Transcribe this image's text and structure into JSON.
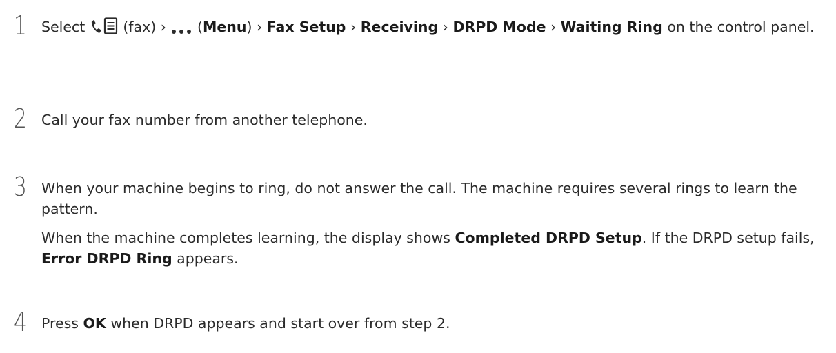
{
  "steps": [
    {
      "number": "1",
      "t_select": "Select",
      "t_fax": "(fax) ›",
      "t_menu_open": "(",
      "menu": "Menu",
      "t_menu_close": ") ›",
      "fax_setup": "Fax Setup",
      "sep1": "›",
      "receiving": "Receiving",
      "sep2": "›",
      "drpd_mode": "DRPD Mode",
      "sep3": "›",
      "waiting_ring": "Waiting Ring",
      "t_tail": "on the control panel."
    },
    {
      "number": "2",
      "text": "Call your fax number from another telephone."
    },
    {
      "number": "3",
      "text1": "When your machine begins to ring, do not answer the call. The machine requires several rings to learn the pattern.",
      "t2a": "When the machine completes learning, the display shows",
      "completed": "Completed DRPD Setup",
      "t2b": ". If the DRPD setup fails,",
      "error": "Error DRPD Ring",
      "t2c": "appears."
    },
    {
      "number": "4",
      "t_press": "Press",
      "ok": "OK",
      "t_tail": "when DRPD appears and start over from step 2."
    }
  ],
  "icons": {
    "fax": "fax-icon",
    "menu": "more-dots-icon"
  },
  "colors": {
    "text": "#2b2b2b",
    "bold": "#1a1a1a",
    "step_number": "#555555"
  }
}
